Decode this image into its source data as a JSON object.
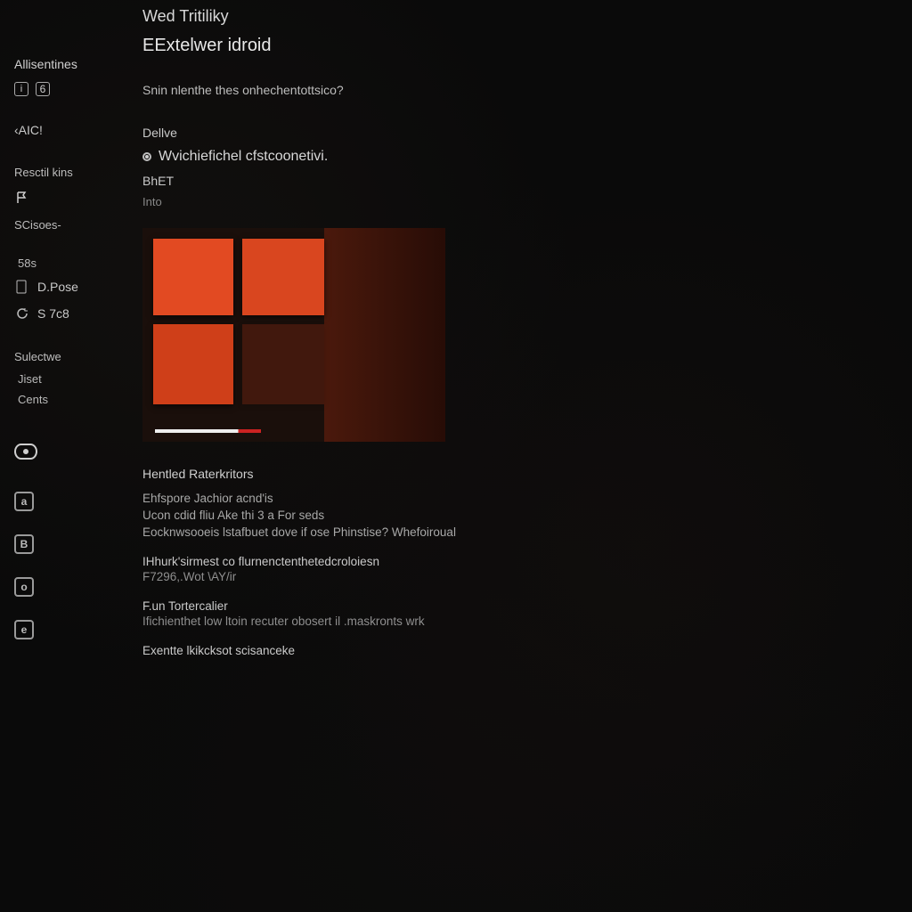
{
  "header": {
    "title": "Wed Tritiliky"
  },
  "sidebar": {
    "top_label": "Allisentines",
    "badge_small": "i",
    "badge_num": "6",
    "group1_label": "‹AIC!",
    "recent_label": "Resctil kins",
    "recent_icon_label": "r1",
    "scoses_label": "SCisoes-",
    "s8s": "58s",
    "dpose": "D.Pose",
    "s7c": "S 7c8",
    "selectwe": "Sulectwe",
    "jiset": "Jiset",
    "cents": "Cents"
  },
  "main": {
    "heading": "EExtelwer idroid",
    "prompt": "Snin nlenthe thes onhechentottsico?",
    "opt_delve": "Dellve",
    "opt_watch": "Wvichiefichel cfstcoonetivi.",
    "opt_bhet": "BhET",
    "opt_into": "Into"
  },
  "info": {
    "header": "Hentled Raterkritors",
    "l1": "Ehfspore Jachior acnd'is",
    "l2": "Ucon cdid fliu Ake thi 3 a For seds",
    "l3": "Eocknwsooeis lstafbuet dove if ose Phinstise? Whefoiroual",
    "blk1_t": "IHhurk'sirmest co flurnenctenthetedcroloiesn",
    "blk1_s": "F7296,.Wot \\AY/ir",
    "blk2_t": "F.un Tortercalier",
    "blk2_s": "Ifichienthet low ltoin recuter obosert il .maskronts wrk",
    "blk3_t": "Exentte lkikcksot scisanceke"
  },
  "icons": {
    "sq_a": "a",
    "sq_b": "B",
    "sq_o": "o",
    "sq_e": "e"
  }
}
